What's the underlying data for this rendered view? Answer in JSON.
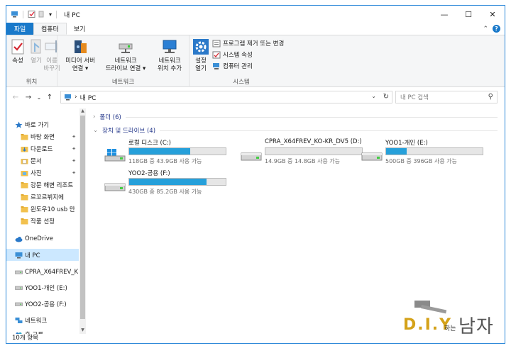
{
  "window": {
    "title": "내 PC",
    "qa_dropdown": "▾",
    "controls": {
      "minimize": "—",
      "maximize": "☐",
      "close": "✕"
    }
  },
  "tabs": {
    "file": "파일",
    "computer": "컴퓨터",
    "view": "보기",
    "collapse": "⌃",
    "help": "?"
  },
  "ribbon": {
    "location": {
      "label": "위치",
      "properties": "속성",
      "open": "열기",
      "rename_l1": "이름",
      "rename_l2": "바꾸기"
    },
    "network": {
      "label": "네트워크",
      "media_l1": "미디어 서버",
      "media_l2": "연결 ▾",
      "map_l1": "네트워크",
      "map_l2": "드라이브 연결 ▾",
      "add_l1": "네트워크",
      "add_l2": "위치 추가"
    },
    "system": {
      "label": "시스템",
      "settings_l1": "설정",
      "settings_l2": "열기",
      "uninstall": "프로그램 제거 또는 변경",
      "sysprops": "시스템 속성",
      "manage": "컴퓨터 관리"
    }
  },
  "nav": {
    "back": "←",
    "forward": "→",
    "recent": "⌄",
    "up": "↑",
    "path_sep": "›",
    "path": "내 PC",
    "dropdown": "⌄",
    "refresh": "↻",
    "search_placeholder": "내 PC 검색",
    "search_icon": "⚲"
  },
  "sidebar": {
    "items": [
      {
        "label": "바로 가기",
        "icon": "star-icon"
      },
      {
        "label": "바탕 화면",
        "icon": "folder-icon",
        "pinned": true
      },
      {
        "label": "다운로드",
        "icon": "download-icon",
        "pinned": true
      },
      {
        "label": "문서",
        "icon": "document-icon",
        "pinned": true
      },
      {
        "label": "사진",
        "icon": "picture-icon",
        "pinned": true
      },
      {
        "label": "강문 해변 리조트",
        "icon": "folder-icon"
      },
      {
        "label": "르꼬르뷔지에",
        "icon": "folder-icon"
      },
      {
        "label": "윈도우10 usb 만",
        "icon": "folder-icon"
      },
      {
        "label": "작품 선정",
        "icon": "folder-icon"
      },
      {
        "label": "OneDrive",
        "icon": "cloud-icon"
      },
      {
        "label": "내 PC",
        "icon": "pc-icon",
        "selected": true
      },
      {
        "label": "CPRA_X64FREV_K",
        "icon": "drive-icon"
      },
      {
        "label": "YOO1-개인 (E:)",
        "icon": "drive-icon"
      },
      {
        "label": "YOO2-공용 (F:)",
        "icon": "drive-icon"
      },
      {
        "label": "네트워크",
        "icon": "network-icon"
      },
      {
        "label": "홈 그룹",
        "icon": "homegroup-icon"
      }
    ],
    "pin_glyph": "📌"
  },
  "content": {
    "folders_header": "폴더 (6)",
    "devices_header": "장치 및 드라이브 (4)",
    "drives": [
      {
        "name": "로컬 디스크 (C:)",
        "size": "118GB 중 43.9GB 사용 가능",
        "used_fraction": 0.63,
        "icon": "windows-drive-icon"
      },
      {
        "name": "CPRA_X64FREV_KO-KR_DV5 (D:)",
        "size": "14.9GB 중 14.8GB 사용 가능",
        "used_fraction": 0.0,
        "icon": "drive-icon"
      },
      {
        "name": "YOO1-개인 (E:)",
        "size": "500GB 중 396GB 사용 가능",
        "used_fraction": 0.21,
        "icon": "drive-icon"
      },
      {
        "name": "YOO2-공용 (F:)",
        "size": "430GB 중 85.2GB 사용 가능",
        "used_fraction": 0.8,
        "icon": "drive-icon"
      }
    ]
  },
  "status": {
    "count": "10개 항목"
  },
  "watermark": {
    "brand": "D.I.Y",
    "mid": "하는",
    "end": "남자"
  }
}
